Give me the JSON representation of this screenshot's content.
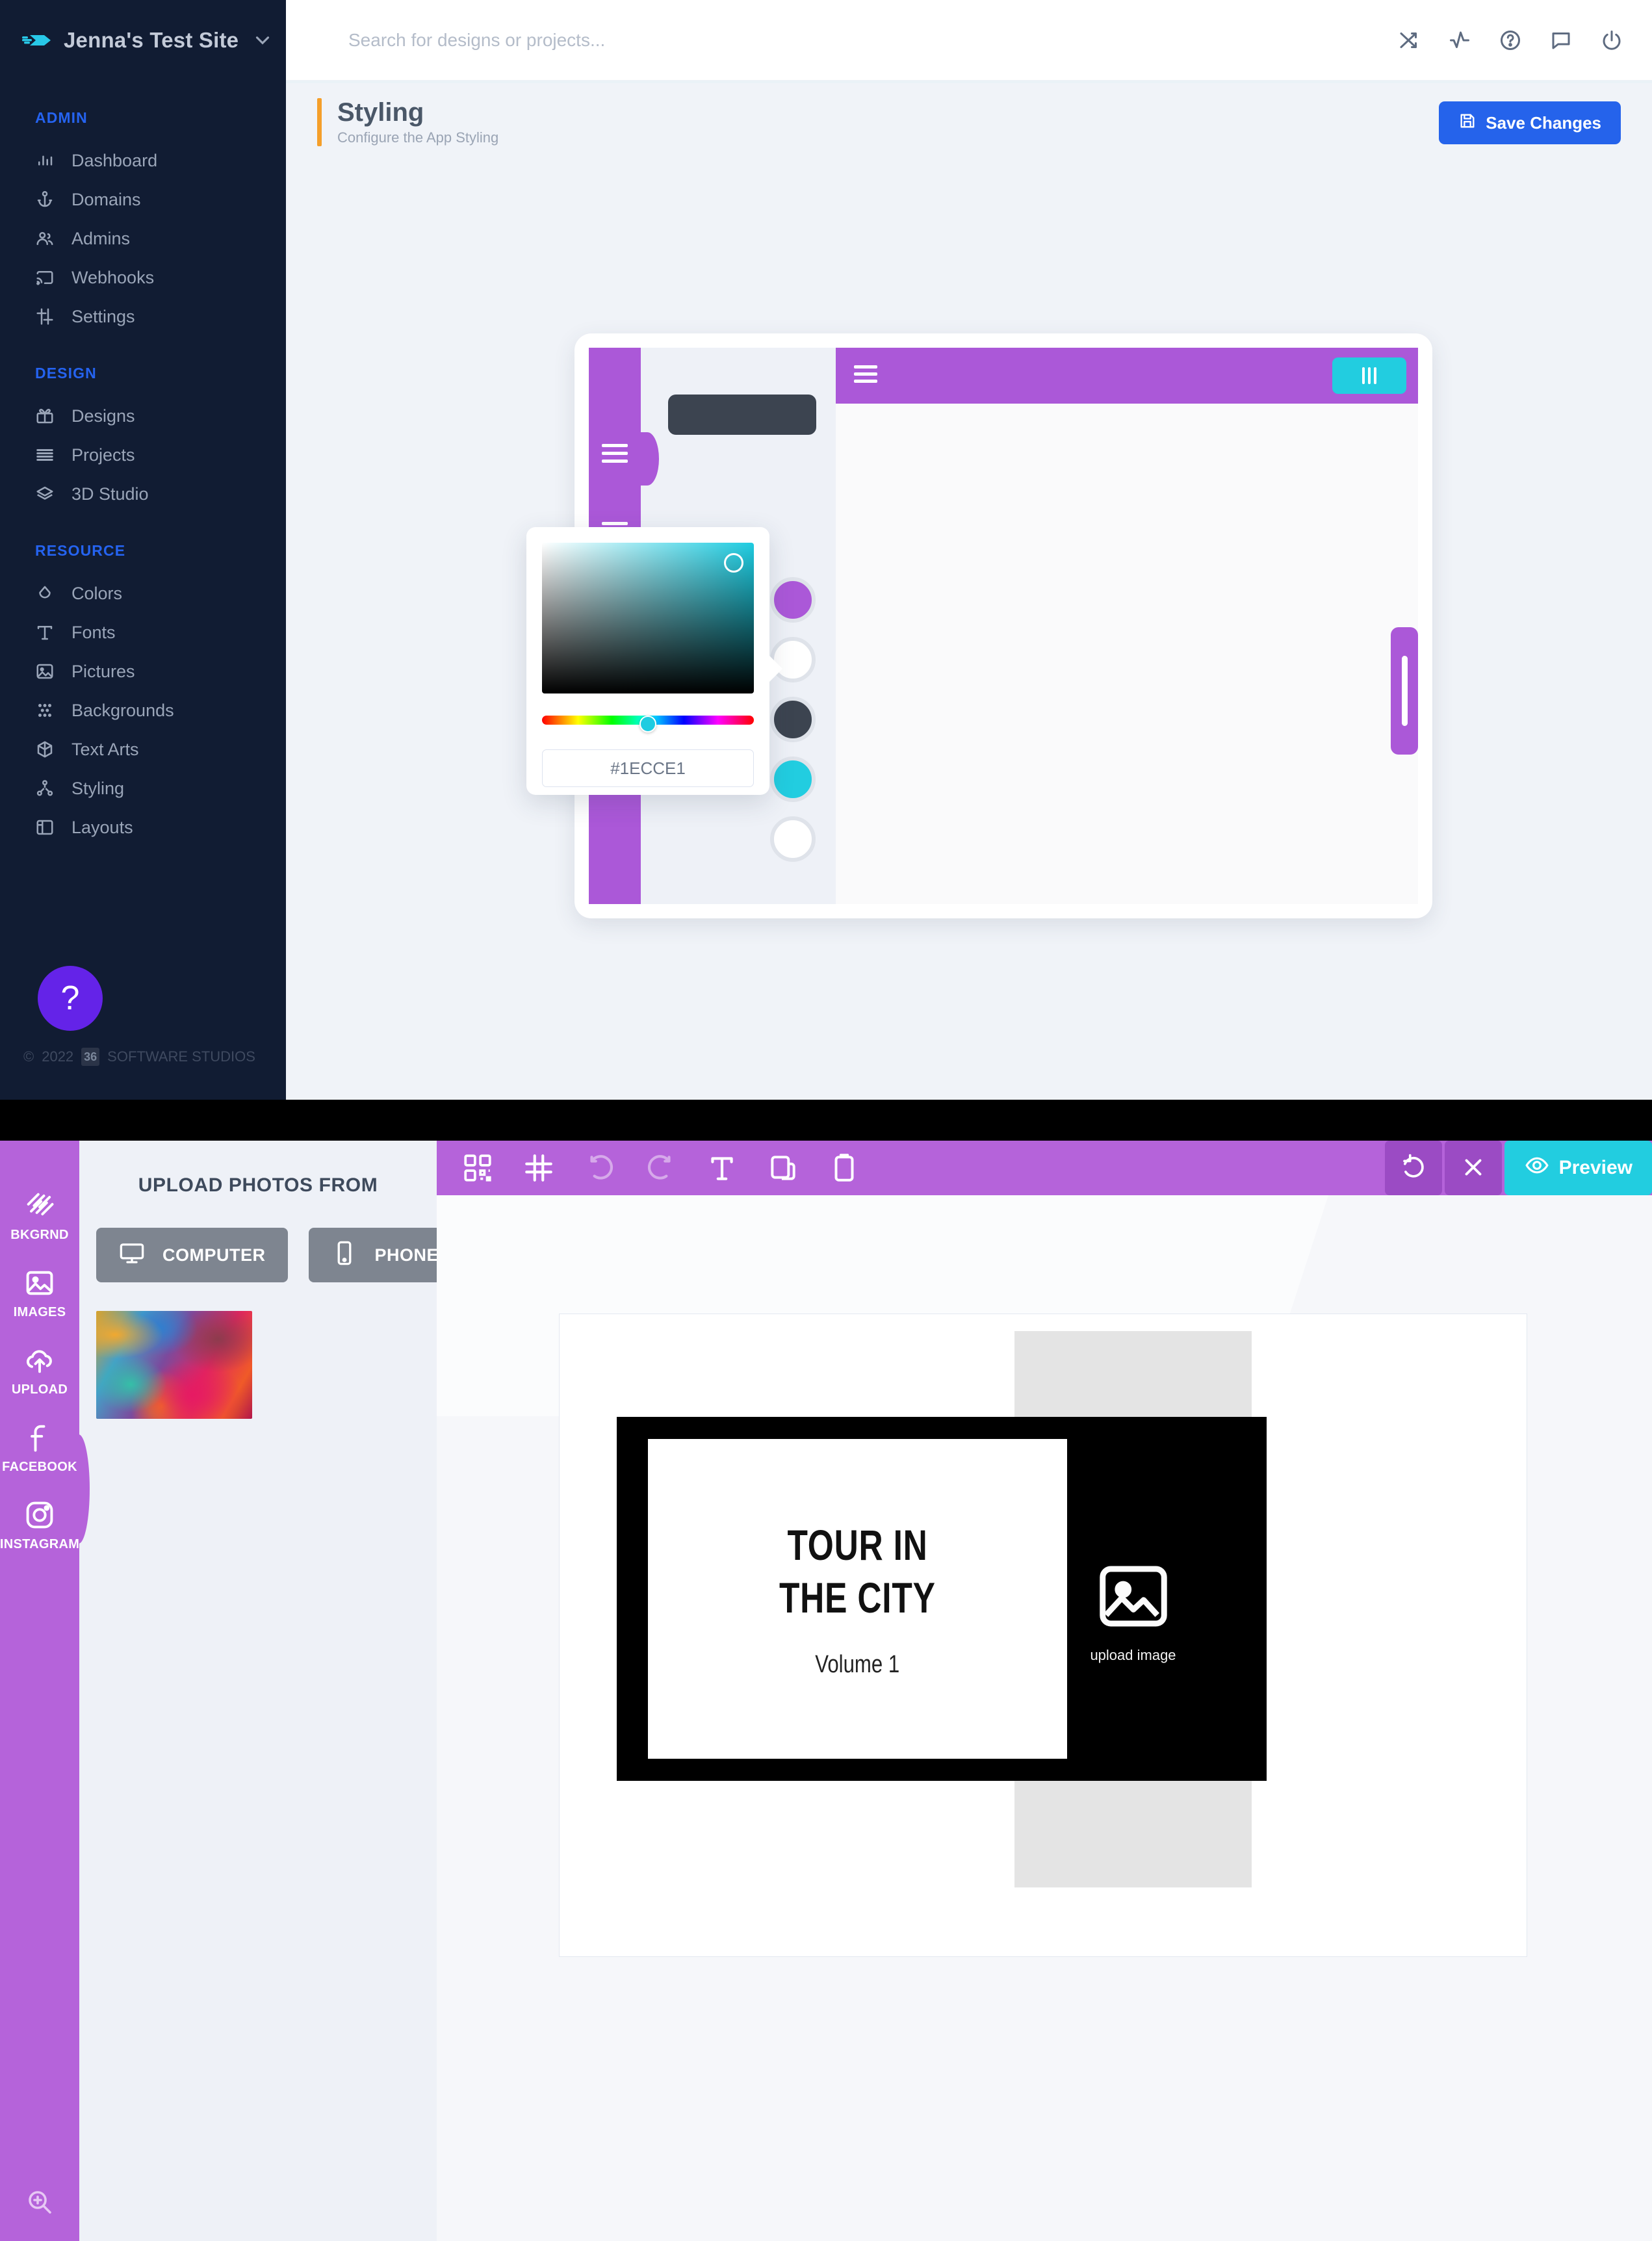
{
  "admin": {
    "brand": {
      "name": "Jenna's Test Site",
      "logo_icon": "rocket-arrow-logo",
      "caret_icon": "chevron-down-icon"
    },
    "sections": [
      {
        "title": "ADMIN",
        "items": [
          {
            "label": "Dashboard",
            "icon": "bar-chart-icon"
          },
          {
            "label": "Domains",
            "icon": "anchor-icon"
          },
          {
            "label": "Admins",
            "icon": "users-icon"
          },
          {
            "label": "Webhooks",
            "icon": "cast-icon"
          },
          {
            "label": "Settings",
            "icon": "sliders-icon"
          }
        ]
      },
      {
        "title": "DESIGN",
        "items": [
          {
            "label": "Designs",
            "icon": "gift-icon"
          },
          {
            "label": "Projects",
            "icon": "list-lines-icon"
          },
          {
            "label": "3D Studio",
            "icon": "cube-icon"
          }
        ]
      },
      {
        "title": "RESOURCE",
        "items": [
          {
            "label": "Colors",
            "icon": "droplet-icon"
          },
          {
            "label": "Fonts",
            "icon": "type-icon"
          },
          {
            "label": "Pictures",
            "icon": "image-icon"
          },
          {
            "label": "Backgrounds",
            "icon": "pattern-icon"
          },
          {
            "label": "Text Arts",
            "icon": "box-3d-icon"
          },
          {
            "label": "Styling",
            "icon": "nodes-icon"
          },
          {
            "label": "Layouts",
            "icon": "layout-icon"
          }
        ]
      }
    ],
    "help_fab": {
      "label": "?",
      "color": "#6423E8"
    },
    "footer": {
      "copyright_mark": "©",
      "year": "2022",
      "badge": "36",
      "company": "SOFTWARE STUDIOS"
    },
    "topbar": {
      "search_placeholder": "Search for designs or projects...",
      "search_value": "",
      "search_icon": "search-icon",
      "calendar_icon": "calendar-icon",
      "icons": [
        {
          "name": "shuffle-icon"
        },
        {
          "name": "activity-icon"
        },
        {
          "name": "help-circle-icon"
        },
        {
          "name": "message-icon"
        },
        {
          "name": "power-icon"
        }
      ]
    },
    "page": {
      "title": "Styling",
      "subtitle": "Configure the App Styling",
      "accent_color": "#F59F2B",
      "save_label": "Save Changes",
      "save_icon": "save-disk-icon",
      "save_color": "#2563EB"
    },
    "color_picker": {
      "hex_value": "#1ECCE1",
      "selected_color": "#1ECCE1",
      "hue_position_pct": 46
    },
    "swatches": [
      {
        "name": "swatch-purple",
        "color": "#AB58D8"
      },
      {
        "name": "swatch-empty",
        "color": "#FFFFFF"
      },
      {
        "name": "swatch-dark",
        "color": "#3C4450"
      },
      {
        "name": "swatch-cyan",
        "color": "#22CDE0"
      },
      {
        "name": "swatch-white",
        "color": "#FFFFFF"
      }
    ],
    "preview_mockup": {
      "rail_color": "#AB58D8",
      "appbar_color": "#AB58D8",
      "accent_chip_color": "#22CDE0",
      "dark_pill_color": "#3C4450"
    }
  },
  "editor": {
    "rail": [
      {
        "label": "BKGRND",
        "icon": "stripes-icon"
      },
      {
        "label": "IMAGES",
        "icon": "image-icon"
      },
      {
        "label": "UPLOAD",
        "icon": "cloud-upload-icon"
      },
      {
        "label": "FACEBOOK",
        "icon": "facebook-icon"
      },
      {
        "label": "INSTAGRAM",
        "icon": "instagram-icon"
      }
    ],
    "active_rail_index": 2,
    "zoom_icon": "zoom-in-icon",
    "panel": {
      "title": "UPLOAD PHOTOS FROM",
      "sources": [
        {
          "label": "COMPUTER",
          "icon": "monitor-icon"
        },
        {
          "label": "PHONE",
          "icon": "phone-icon"
        }
      ],
      "thumbnail_name": "uploaded-photo-thumbnail"
    },
    "toolbar": {
      "color": "#B563DA",
      "tools": [
        {
          "name": "qr-code-icon",
          "dim": false
        },
        {
          "name": "grid-icon",
          "dim": false
        },
        {
          "name": "undo-icon",
          "dim": true
        },
        {
          "name": "redo-icon",
          "dim": true
        },
        {
          "name": "text-tool-icon",
          "dim": false
        },
        {
          "name": "copy-icon",
          "dim": false
        },
        {
          "name": "paste-icon",
          "dim": false
        }
      ],
      "refresh_icon": "refresh-icon",
      "close_icon": "close-icon",
      "preview_label": "Preview",
      "preview_icon": "eye-icon",
      "preview_color": "#22CDE0"
    },
    "canvas": {
      "title_line1": "TOUR IN",
      "title_line2": "THE CITY",
      "volume_label": "Volume 1",
      "upload_placeholder_caption": "upload image",
      "upload_placeholder_icon": "image-placeholder-icon"
    }
  }
}
